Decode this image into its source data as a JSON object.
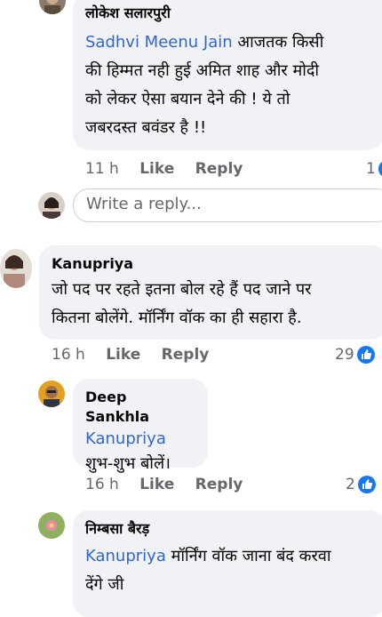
{
  "comments": [
    {
      "author": "लोकेश सलारपुरी",
      "mention": "Sadhvi Meenu Jain",
      "lines": [
        "आजतक किसी",
        "की हिम्मत नही हुई अमित शाह और मोदी",
        "को लेकर ऐसा बयान देने की ! ये तो",
        "जबरदस्त बवंडर है !!"
      ],
      "time": "11 h",
      "like": "Like",
      "reply": "Reply",
      "reactions": "1"
    },
    {
      "author": "Kanupriya",
      "lines": [
        "जो पद पर रहते इतना बोल रहे हैं पद जाने पर",
        "कितना बोलेंगे. मॉर्निंग वॉक का ही सहारा है."
      ],
      "time": "16 h",
      "like": "Like",
      "reply": "Reply",
      "reactions": "29"
    },
    {
      "author": "Deep Sankhla",
      "mention": "Kanupriya",
      "lines": [
        "शुभ-शुभ बोलें।"
      ],
      "time": "16 h",
      "like": "Like",
      "reply": "Reply",
      "reactions": "2"
    },
    {
      "author": "निम्बसा बैरड़",
      "mention": "Kanupriya",
      "lines": [
        "मॉर्निंग वॉक जाना बंद करवा",
        "देंगे जी"
      ]
    }
  ],
  "reply_box": {
    "placeholder": "Write a reply..."
  },
  "colors": {
    "bubble": "#f0f2f5",
    "mention": "#3366cc",
    "meta": "#65676b",
    "like_blue": "#1877f2"
  }
}
